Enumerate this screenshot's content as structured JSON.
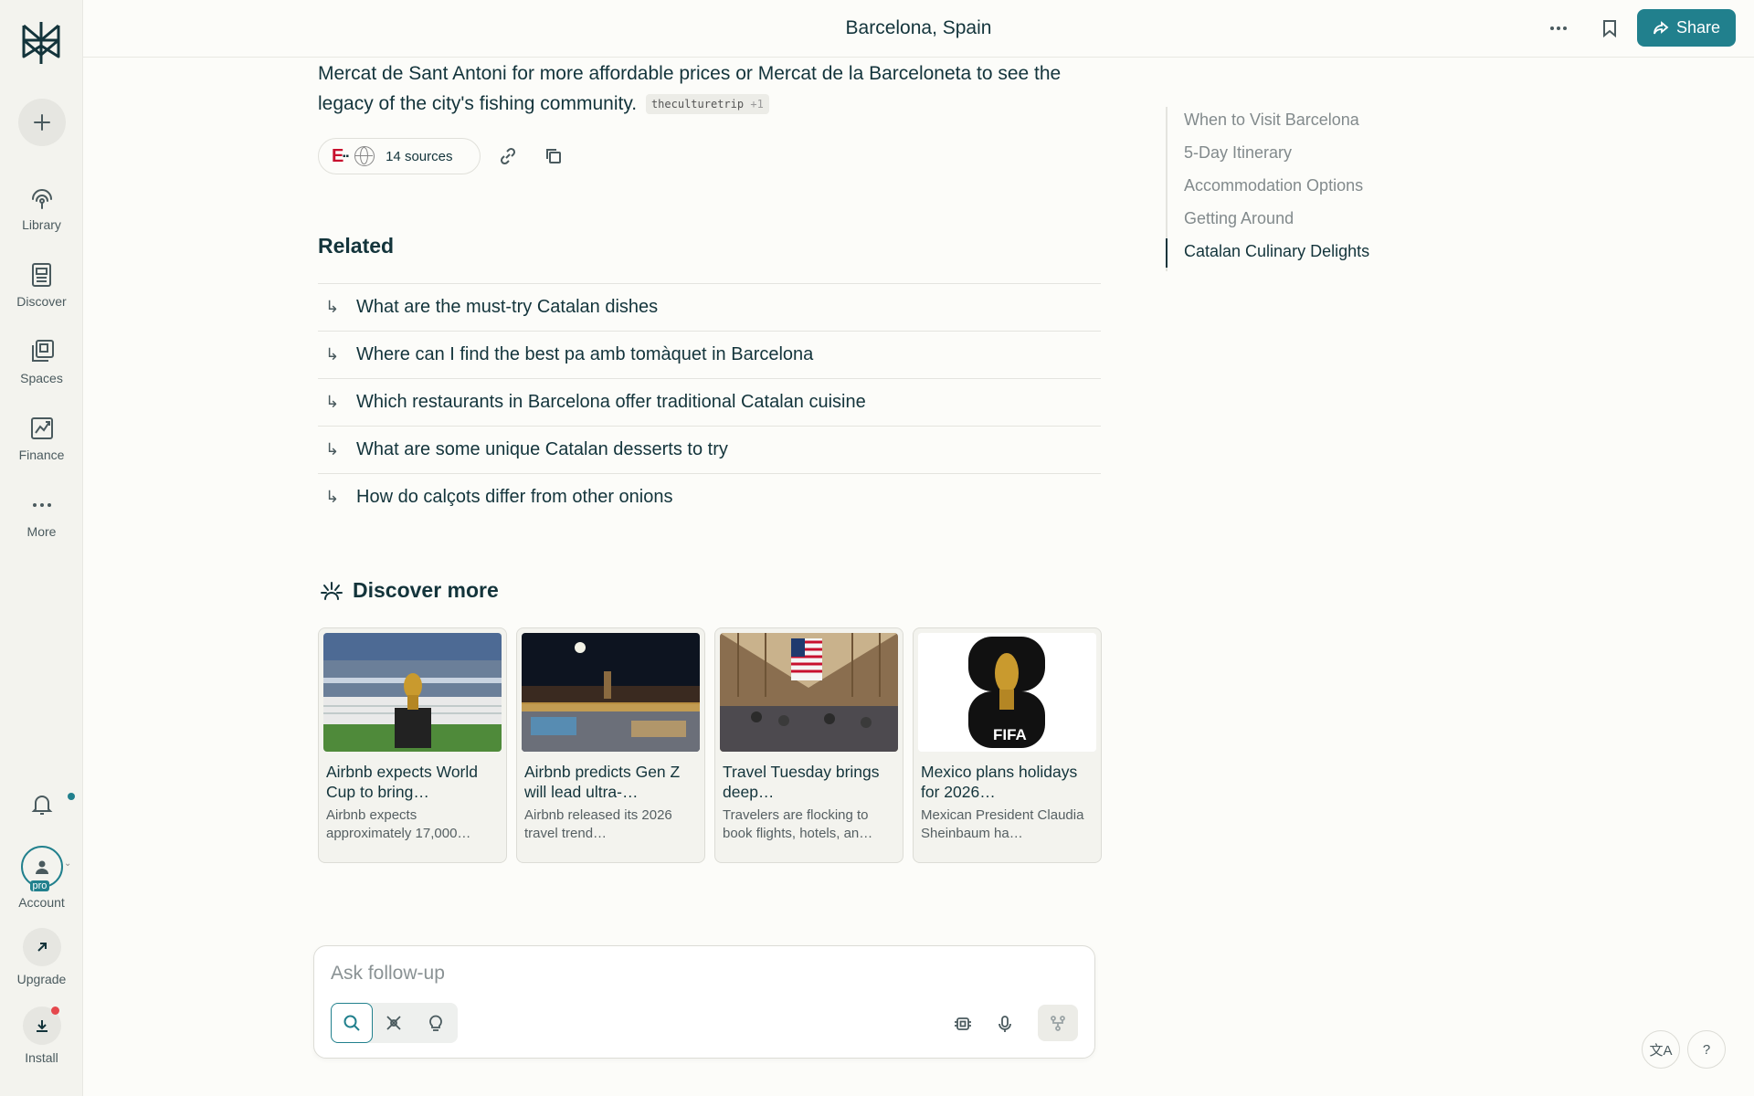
{
  "sidebar": {
    "nav": [
      {
        "label": "Library",
        "icon": "library-icon"
      },
      {
        "label": "Discover",
        "icon": "discover-icon"
      },
      {
        "label": "Spaces",
        "icon": "spaces-icon"
      },
      {
        "label": "Finance",
        "icon": "finance-icon"
      },
      {
        "label": "More",
        "icon": "more-icon"
      }
    ],
    "account_label": "Account",
    "pro_badge": "pro",
    "upgrade_label": "Upgrade",
    "install_label": "Install"
  },
  "header": {
    "title": "Barcelona, Spain",
    "share_label": "Share"
  },
  "answer": {
    "paragraph": "Mercat de Sant Antoni for more affordable prices or Mercat de la Barceloneta to see the legacy of the city's fishing community.",
    "citation": "theculturetrip",
    "citation_more": "+1",
    "sources_label": "14 sources"
  },
  "related": {
    "title": "Related",
    "items": [
      "What are the must-try Catalan dishes",
      "Where can I find the best pa amb tomàquet in Barcelona",
      "Which restaurants in Barcelona offer traditional Catalan cuisine",
      "What are some unique Catalan desserts to try",
      "How do calçots differ from other onions"
    ]
  },
  "discover": {
    "title": "Discover more",
    "cards": [
      {
        "title": "Airbnb expects World Cup to bring…",
        "snippet": "Airbnb expects approximately 17,000…"
      },
      {
        "title": "Airbnb predicts Gen Z will lead ultra-…",
        "snippet": "Airbnb released its 2026 travel trend…"
      },
      {
        "title": "Travel Tuesday brings deep…",
        "snippet": "Travelers are flocking to book flights, hotels, an…"
      },
      {
        "title": "Mexico plans holidays for 2026…",
        "snippet": "Mexican President Claudia Sheinbaum ha…"
      }
    ],
    "fifa_text": "FIFA"
  },
  "outline": {
    "items": [
      "When to Visit Barcelona",
      "5-Day Itinerary",
      "Accommodation Options",
      "Getting Around",
      "Catalan Culinary Delights"
    ],
    "active_index": 4
  },
  "askbar": {
    "placeholder": "Ask follow-up"
  },
  "colors": {
    "accent": "#21808d",
    "text": "#13343b",
    "background": "#fcfcf9",
    "sidebar": "#f3f3ee"
  }
}
